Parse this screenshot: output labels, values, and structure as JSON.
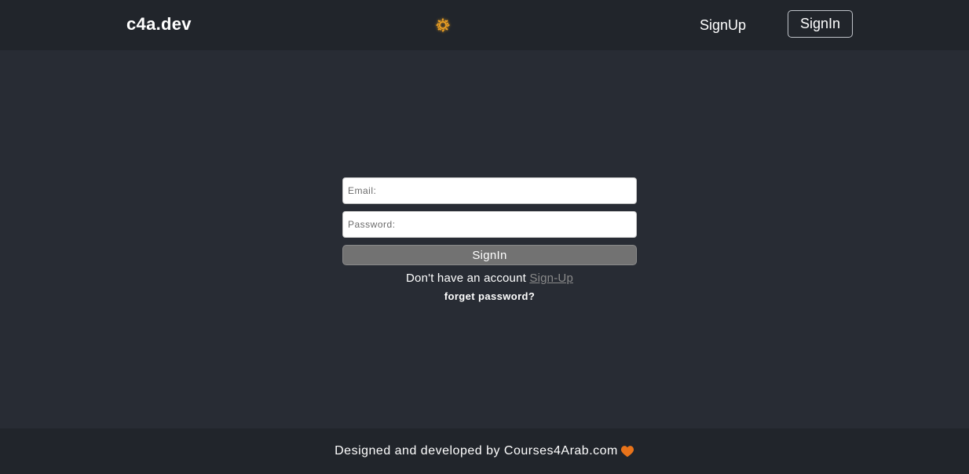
{
  "header": {
    "brand": "c4a.dev",
    "theme_icon": "sun-gear-icon",
    "signup_label": "SignUp",
    "signin_label": "SignIn"
  },
  "form": {
    "email_placeholder": "Email:",
    "password_placeholder": "Password:",
    "submit_label": "SignIn",
    "no_account_text": "Don't have an account",
    "signup_link": "Sign-Up",
    "forget_password": "forget password?"
  },
  "footer": {
    "text": "Designed and developed by Courses4Arab.com",
    "heart_icon": "heart-icon"
  },
  "colors": {
    "background": "#282c34",
    "header_bg": "#21252b",
    "accent_sun": "#f5a623",
    "heart": "#e8731a",
    "button_bg": "#727272"
  }
}
